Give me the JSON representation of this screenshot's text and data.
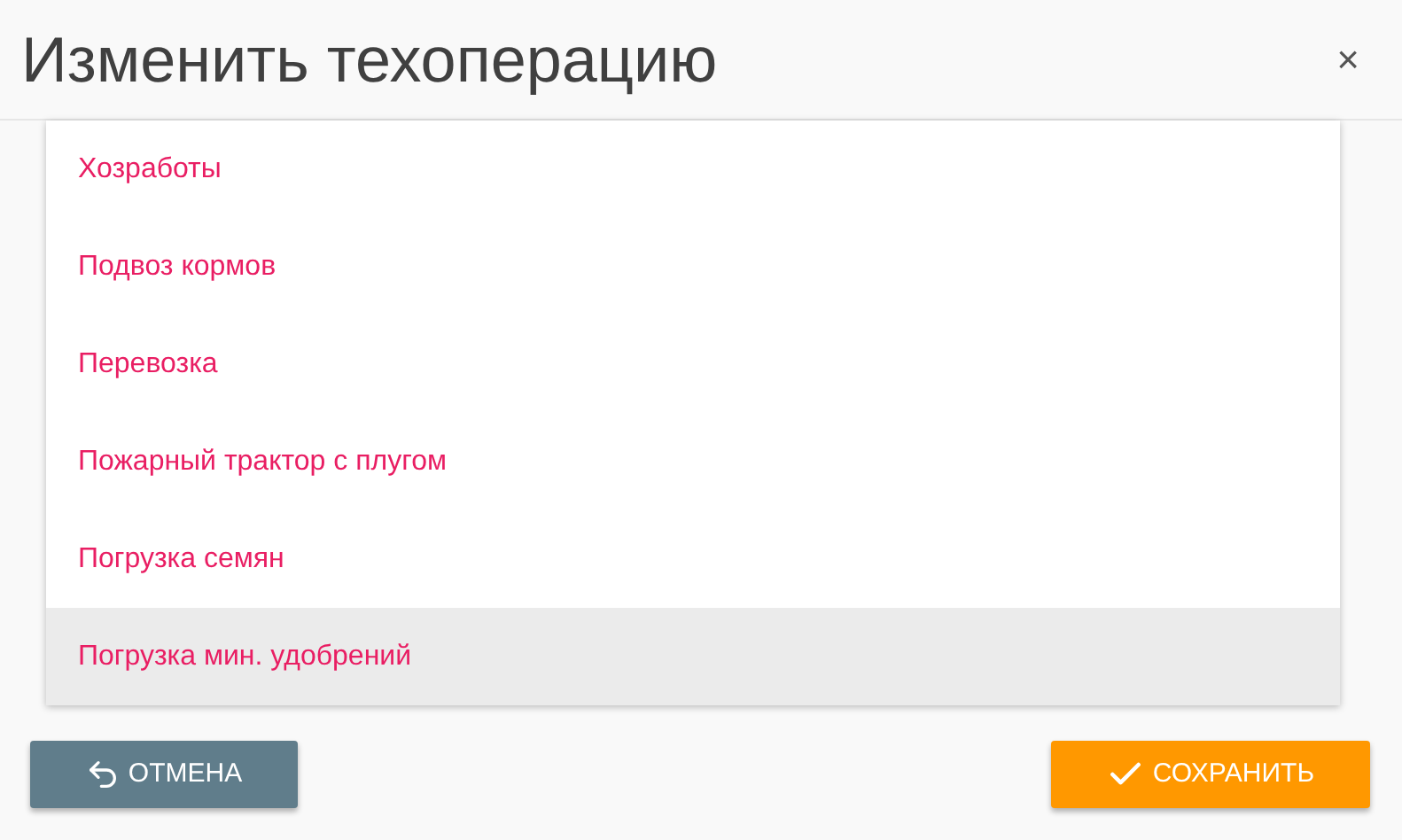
{
  "dialog": {
    "title": "Изменить техоперацию",
    "close": "×"
  },
  "list": {
    "items": [
      {
        "label": "Хозработы",
        "selected": false
      },
      {
        "label": "Подвоз кормов",
        "selected": false
      },
      {
        "label": "Перевозка",
        "selected": false
      },
      {
        "label": "Пожарный трактор с плугом",
        "selected": false
      },
      {
        "label": "Погрузка семян",
        "selected": false
      },
      {
        "label": "Погрузка мин. удобрений",
        "selected": true
      }
    ]
  },
  "buttons": {
    "cancel": "ОТМЕНА",
    "save": "СОХРАНИТЬ"
  }
}
